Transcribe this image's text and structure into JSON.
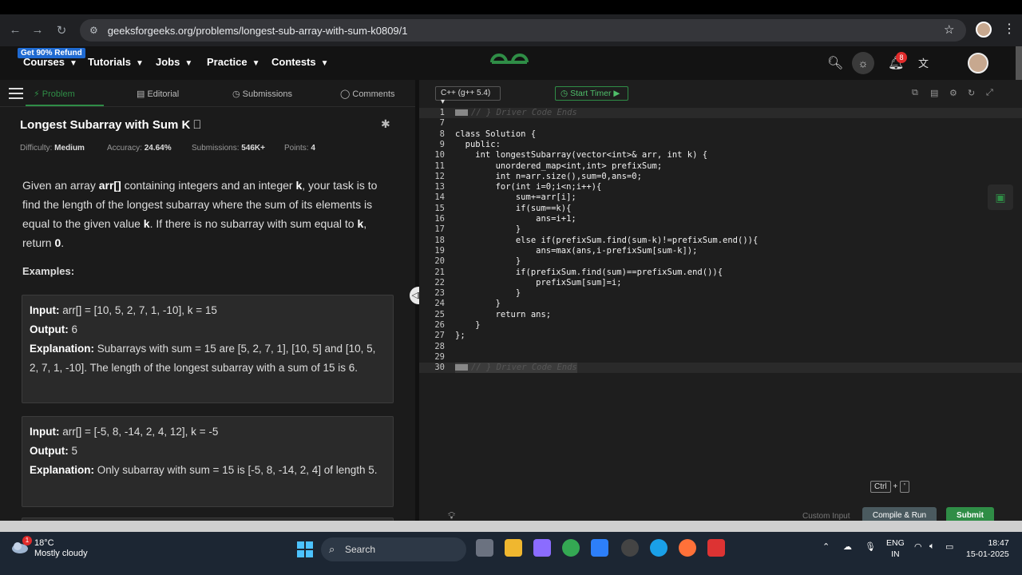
{
  "browser": {
    "url": "geeksforgeeks.org/problems/longest-sub-array-with-sum-k0809/1",
    "nav_back": "←",
    "nav_forward": "→",
    "reload": "↻"
  },
  "header": {
    "promo": "Get 90% Refund",
    "nav": [
      "Courses",
      "Tutorials",
      "Jobs",
      "Practice",
      "Contests"
    ],
    "notification_count": "8"
  },
  "tabs": {
    "problem": "Problem",
    "editorial": "Editorial",
    "submissions": "Submissions",
    "comments": "Comments"
  },
  "problem": {
    "title": "Longest Subarray with Sum K",
    "difficulty_label": "Difficulty:",
    "difficulty": "Medium",
    "accuracy_label": "Accuracy:",
    "accuracy": "24.64%",
    "submissions_label": "Submissions:",
    "submissions": "546K+",
    "points_label": "Points:",
    "points": "4",
    "examples_heading": "Examples:"
  },
  "examples": [
    {
      "input_label": "Input:",
      "input": " arr[] = [10, 5, 2, 7, 1, -10], k = 15",
      "output_label": "Output:",
      "output": " 6",
      "explanation_label": "Explanation:",
      "explanation": " Subarrays with sum = 15 are [5, 2, 7, 1], [10, 5] and [10, 5, 2, 7, 1, -10]. The length of the longest subarray with a sum of 15 is 6."
    },
    {
      "input_label": "Input:",
      "input": " arr[] = [-5, 8, -14, 2, 4, 12], k = -5",
      "output_label": "Output:",
      "output": " 5",
      "explanation_label": "Explanation:",
      "explanation": " Only subarray with sum = 15 is [-5, 8, -14, 2, 4] of length 5."
    }
  ],
  "editor": {
    "language": "C++ (g++ 5.4)",
    "timer_label": "Start Timer",
    "lines": [
      {
        "n": "1",
        "text": "// } Driver Code Ends"
      },
      {
        "n": "7",
        "text": ""
      },
      {
        "n": "8",
        "text": "class Solution {"
      },
      {
        "n": "9",
        "text": "  public:"
      },
      {
        "n": "10",
        "text": "    int longestSubarray(vector<int>& arr, int k) {"
      },
      {
        "n": "11",
        "text": "        unordered_map<int,int> prefixSum;"
      },
      {
        "n": "12",
        "text": "        int n=arr.size(),sum=0,ans=0;"
      },
      {
        "n": "13",
        "text": "        for(int i=0;i<n;i++){"
      },
      {
        "n": "14",
        "text": "            sum+=arr[i];"
      },
      {
        "n": "15",
        "text": "            if(sum==k){"
      },
      {
        "n": "16",
        "text": "                ans=i+1;"
      },
      {
        "n": "17",
        "text": "            }"
      },
      {
        "n": "18",
        "text": "            else if(prefixSum.find(sum-k)!=prefixSum.end()){"
      },
      {
        "n": "19",
        "text": "                ans=max(ans,i-prefixSum[sum-k]);"
      },
      {
        "n": "20",
        "text": "            }"
      },
      {
        "n": "21",
        "text": "            if(prefixSum.find(sum)==prefixSum.end()){"
      },
      {
        "n": "22",
        "text": "                prefixSum[sum]=i;"
      },
      {
        "n": "23",
        "text": "            }"
      },
      {
        "n": "24",
        "text": "        }"
      },
      {
        "n": "25",
        "text": "        return ans;"
      },
      {
        "n": "26",
        "text": "    }"
      },
      {
        "n": "27",
        "text": "};"
      },
      {
        "n": "28",
        "text": ""
      },
      {
        "n": "29",
        "text": ""
      },
      {
        "n": "30",
        "text": "// } Driver Code Ends"
      }
    ],
    "shortcut_key": "Ctrl",
    "shortcut_plus": "+",
    "shortcut_second": "'",
    "custom_input": "Custom Input",
    "compile_run": "Compile & Run",
    "submit": "Submit"
  },
  "taskbar": {
    "weather_temp": "18°C",
    "weather_desc": "Mostly cloudy",
    "weather_badge": "1",
    "search_label": "Search",
    "lang_top": "ENG",
    "lang_bottom": "IN",
    "time": "18:47",
    "date": "15-01-2025"
  },
  "colors": {
    "gfg_green": "#2f8d46",
    "badge_red": "#e02b2b",
    "accent_blue": "#1f6ad1"
  }
}
